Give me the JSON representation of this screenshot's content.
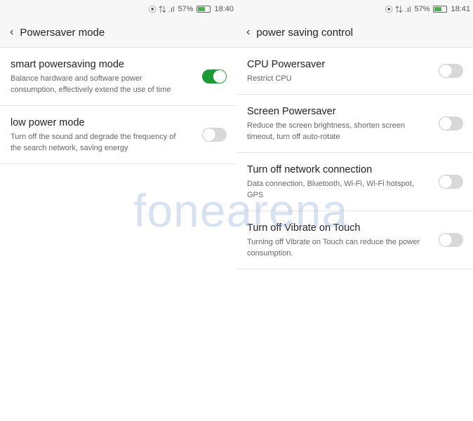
{
  "left": {
    "status": {
      "battery_pct": "57%",
      "battery_level": 0.57,
      "time": "18:40"
    },
    "title": "Powersaver mode",
    "items": [
      {
        "title": "smart powersaving mode",
        "desc": "Balance hardware and software power consumption, effectively extend the use of time",
        "on": true
      },
      {
        "title": "low power mode",
        "desc": "Turn off the sound and degrade the frequency of the search network, saving energy",
        "on": false
      }
    ]
  },
  "right": {
    "status": {
      "battery_pct": "57%",
      "battery_level": 0.57,
      "time": "18:41"
    },
    "title": "power saving control",
    "items": [
      {
        "title": "CPU Powersaver",
        "desc": "Restrict CPU",
        "on": false
      },
      {
        "title": "Screen Powersaver",
        "desc": "Reduce the screen brightness, shorten screen timeout, turn off auto-rotate",
        "on": false
      },
      {
        "title": "Turn off network connection",
        "desc": "Data connection, Bluetooth, Wi-Fi, Wi-Fi hotspot, GPS",
        "on": false
      },
      {
        "title": "Turn off Vibrate on Touch",
        "desc": "Turning off Vibrate on Touch can reduce the power consumption.",
        "on": false
      }
    ]
  },
  "watermark": "fonearena",
  "colors": {
    "accent": "#1a9b36"
  }
}
